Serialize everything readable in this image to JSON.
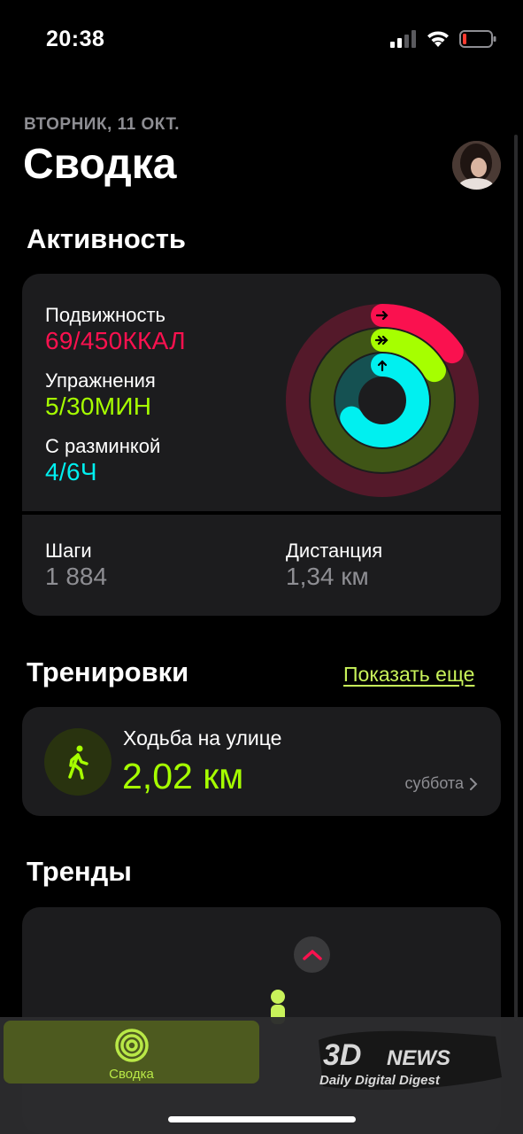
{
  "status_bar": {
    "time": "20:38"
  },
  "header": {
    "date": "ВТОРНИК, 11 ОКТ.",
    "title": "Сводка"
  },
  "activity": {
    "section_title": "Активность",
    "move": {
      "label": "Подвижность",
      "value": "69/450ККАЛ",
      "progress": 0.153,
      "color": "#fa114f"
    },
    "exercise": {
      "label": "Упражнения",
      "value": "5/30МИН",
      "progress": 0.167,
      "color": "#a6ff00"
    },
    "stand": {
      "label": "С разминкой",
      "value": "4/6Ч",
      "progress": 0.667,
      "color": "#00f0f0"
    },
    "steps": {
      "label": "Шаги",
      "value": "1 884"
    },
    "distance": {
      "label": "Дистанция",
      "value": "1,34 км"
    }
  },
  "workouts": {
    "section_title": "Тренировки",
    "show_more": "Показать еще",
    "item": {
      "name": "Ходьба на улице",
      "value": "2,02 км",
      "day": "суббота",
      "icon": "walking-icon"
    }
  },
  "trends": {
    "section_title": "Тренды",
    "badge_icon": "chevron-up-icon"
  },
  "tab_bar": {
    "summary_label": "Сводка",
    "summary_icon": "activity-rings-icon"
  },
  "watermark": {
    "logo": "3DNEWS",
    "tagline": "Daily Digital Digest"
  }
}
